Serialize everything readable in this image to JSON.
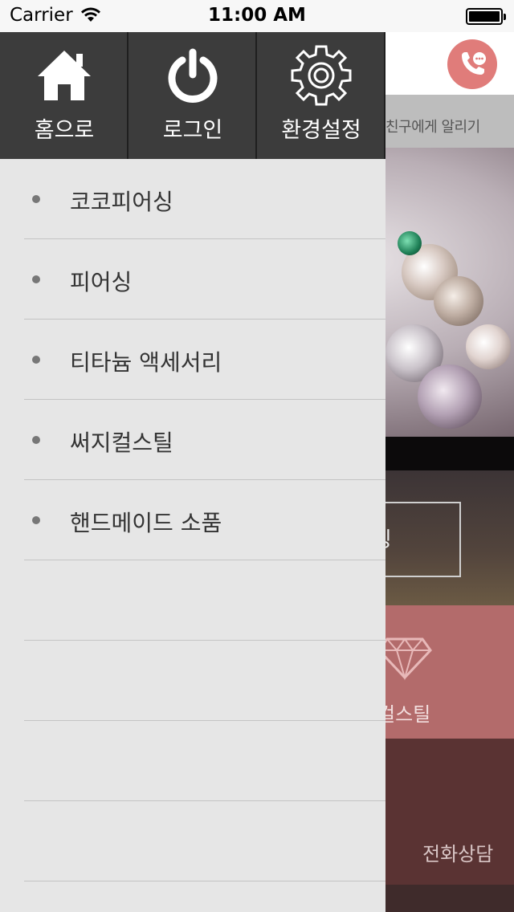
{
  "status_bar": {
    "carrier": "Carrier",
    "time": "11:00 AM"
  },
  "drawer": {
    "toolbar": {
      "home_label": "홈으로",
      "login_label": "로그인",
      "settings_label": "환경설정"
    },
    "menu_items": [
      {
        "label": "코코피어싱"
      },
      {
        "label": "피어싱"
      },
      {
        "label": "티타늄 액세서리"
      },
      {
        "label": "써지컬스틸"
      },
      {
        "label": "핸드메이드 소품"
      },
      {
        "label": ""
      },
      {
        "label": ""
      },
      {
        "label": ""
      },
      {
        "label": ""
      }
    ]
  },
  "background": {
    "share_label": "친구에게 알리기",
    "categories": {
      "piercing": "어싱",
      "surgical": "컬스틸",
      "phone": "전화상담"
    }
  },
  "colors": {
    "toolbar_bg": "#3c3c3c",
    "drawer_bg": "#e6e6e6",
    "call_button": "#e07c7a",
    "surgical_bg": "#b36b6b",
    "phone_bg": "#5a3333"
  }
}
